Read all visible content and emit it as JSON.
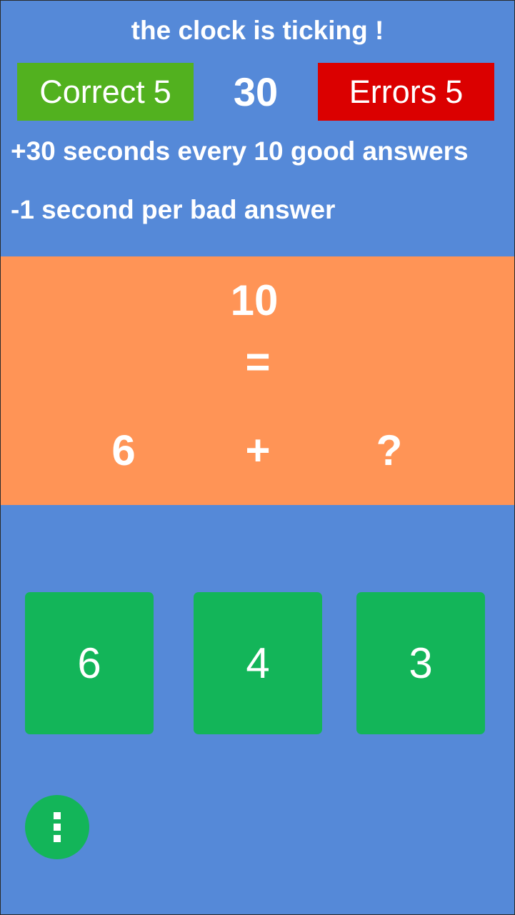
{
  "header": {
    "message": "the clock is ticking !"
  },
  "score": {
    "correct_label": "Correct",
    "correct_count": "5",
    "errors_label": "Errors",
    "errors_count": "5",
    "timer_seconds": "30"
  },
  "rules": [
    "+30 seconds every 10 good answers",
    "-1 second per bad answer"
  ],
  "equation": {
    "result": "10",
    "equals": "=",
    "operand_a": "6",
    "operator": "+",
    "unknown": "?"
  },
  "answers": [
    {
      "label": "6"
    },
    {
      "label": "4"
    },
    {
      "label": "3"
    }
  ],
  "menu": {
    "icon": "more-vertical-icon"
  },
  "colors": {
    "background": "#5589d8",
    "correct": "#52b11f",
    "errors": "#db0000",
    "equation_panel": "#ff9456",
    "answer_button": "#13b559",
    "menu_button": "#13b559"
  }
}
